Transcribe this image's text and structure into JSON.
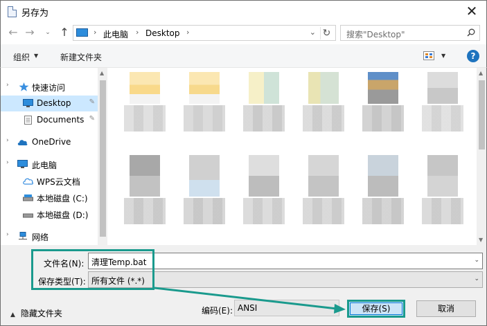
{
  "window": {
    "title": "另存为",
    "close_symbol": "✕"
  },
  "nav": {
    "back_symbol": "←",
    "forward_symbol": "→",
    "recent_symbol": "⌄",
    "up_symbol": "↑",
    "address_segments": [
      "此电脑",
      "Desktop"
    ],
    "chevron": "›",
    "dropdown_symbol": "⌄",
    "refresh_symbol": "↻",
    "search_placeholder": "搜索\"Desktop\""
  },
  "toolbar": {
    "organize_label": "组织",
    "organize_arrow": "▼",
    "new_folder_label": "新建文件夹",
    "view_arrow": "▼",
    "help_label": "?"
  },
  "sidebar": {
    "scroll_up": "▲",
    "items": [
      {
        "label": "快速访问",
        "icon": "star-icon",
        "expander": "›"
      },
      {
        "label": "Desktop",
        "icon": "desktop-icon",
        "pin": "📌",
        "selected": true
      },
      {
        "label": "Documents",
        "icon": "documents-icon",
        "pin": "📌"
      },
      {
        "label": "OneDrive",
        "icon": "cloud-icon",
        "expander": "›"
      },
      {
        "label": "此电脑",
        "icon": "computer-icon",
        "expander": "›"
      },
      {
        "label": "WPS云文档",
        "icon": "wps-cloud-icon"
      },
      {
        "label": "本地磁盘 (C:)",
        "icon": "drive-icon"
      },
      {
        "label": "本地磁盘 (D:)",
        "icon": "drive-icon"
      },
      {
        "label": "网络",
        "icon": "network-icon",
        "expander": "›"
      }
    ]
  },
  "main_scroll": {
    "up": "▲",
    "down": "▼"
  },
  "form": {
    "filename_label": "文件名(N):",
    "filename_value": "清理Temp.bat",
    "filetype_label": "保存类型(T):",
    "filetype_value": "所有文件  (*.*)",
    "dropdown_symbol": "⌄",
    "hide_folders_arrow": "▲",
    "hide_folders_label": "隐藏文件夹",
    "encoding_label": "编码(E):",
    "encoding_value": "ANSI",
    "save_label": "保存(S)",
    "cancel_label": "取消"
  },
  "colors": {
    "annotation": "#1a9a8d",
    "selection": "#cce8ff",
    "accent": "#0078d7"
  }
}
